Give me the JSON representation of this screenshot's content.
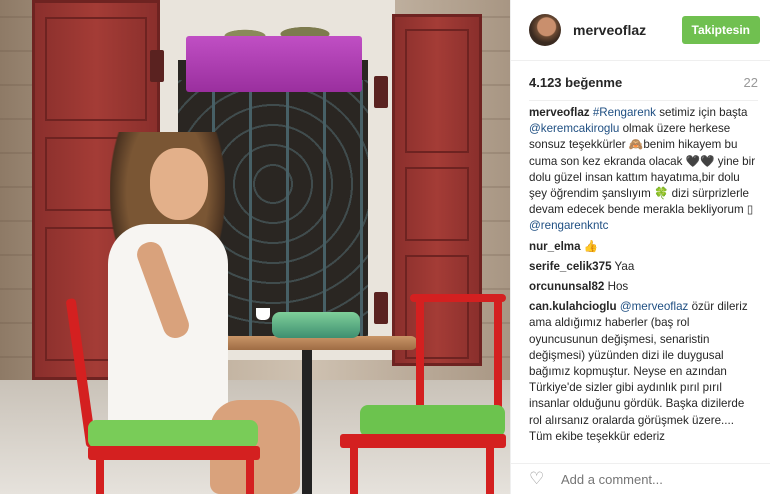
{
  "post": {
    "username": "merveoflaz",
    "follow_label": "Takiptesin",
    "likes_text": "4.123 beğenme",
    "time_text": "22",
    "caption": {
      "user": "merveoflaz",
      "hashtag": "#Rengarenk",
      "text_1": " setimiz için başta ",
      "mention_1": "@keremcakiroglu",
      "text_2": " olmak üzere herkese sonsuz teşekkürler 🙈benim hikayem bu cuma son kez ekranda olacak 🖤🖤 yine bir dolu güzel insan kattım hayatıma,bir dolu şey öğrendim şanslıyım 🍀 dizi sürprizlerle devam edecek bende merakla bekliyorum ▯ ",
      "mention_2": "@rengarenkntc"
    },
    "comments": [
      {
        "user": "nur_elma",
        "text": " 👍"
      },
      {
        "user": "serife_celik375",
        "text": " Yaa"
      },
      {
        "user": "orcununsal82",
        "text": " Hos"
      }
    ],
    "long_comment": {
      "user": "can.kulahcioglu",
      "mention": "@merveoflaz",
      "text": " özür dileriz ama aldığımız haberler (baş rol oyuncusunun değişmesi, senaristin değişmesi) yüzünden dizi ile duygusal bağımız kopmuştur. Neyse en azından Türkiye'de sizler gibi aydınlık pırıl pırıl insanlar olduğunu gördük. Başka dizilerde rol alırsanız oralarda görüşmek üzere.... Tüm ekibe teşekkür ederiz"
    },
    "add_comment_placeholder": "Add a comment..."
  },
  "icons": {
    "heart": "heart-icon"
  }
}
